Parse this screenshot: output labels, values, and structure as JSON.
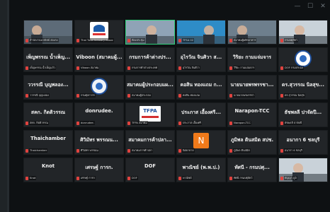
{
  "window": {
    "controls": [
      "—",
      "☐",
      "✕"
    ]
  },
  "colors": {
    "muted_mic": "#e0433f",
    "active_speaker": "#2fd07a",
    "avatar_n": "#f07a1a"
  },
  "tiles": [
    {
      "name": "",
      "label": "สำนักงานพาณิชย์ ฮ่องกง",
      "kind": "video"
    },
    {
      "name": "",
      "label": "Thai Tuna Industry Assoc",
      "kind": "logo"
    },
    {
      "name": "",
      "label": "ห้องประชุม",
      "kind": "video-room",
      "active": true
    },
    {
      "name": "",
      "label": "TFSA 02",
      "kind": "video"
    },
    {
      "name": "",
      "label": "สมาคมผู้ผลิตอาหาร",
      "kind": "video"
    },
    {
      "name": "",
      "label": "กรมปศุสัตว์",
      "kind": "video"
    },
    {
      "name": "เพ็ญพรรณ น้ำเพ็ญ...",
      "label": "เพ็ญพรรณ น้ำเพ็ญแก้ว",
      "kind": "name"
    },
    {
      "name": "Viboon (สมาคมผู้...",
      "label": "Viboon สมาคม",
      "kind": "name"
    },
    {
      "name": "กรมการค้าต่างปร...",
      "label": "กรมการค้าต่างประเทศ",
      "kind": "name"
    },
    {
      "name": "อุไรวัณ จินศิวา ส...",
      "label": "อุไรวัณ จินศิวา",
      "kind": "name"
    },
    {
      "name": "วิริยะ กามแจ่มจาร",
      "label": "วิริยะ กามแจ่มจาร",
      "kind": "name"
    },
    {
      "name": "",
      "label": "DOF กรมประมง",
      "kind": "logo-seal"
    },
    {
      "name": "ววรรณี บุญพลอง...",
      "label": "ววรรณี บุญพลอง",
      "kind": "name"
    },
    {
      "name": "",
      "label": "กรมศุลกากร",
      "kind": "logo-seal-blue"
    },
    {
      "name": "สมาคมผู้ประกอบแผ...",
      "label": "สมาคมผู้ประกอบ",
      "kind": "name"
    },
    {
      "name": "คอสิน ทองแถม ก...",
      "label": "คอสิน ทองแถม",
      "kind": "name"
    },
    {
      "name": "นายนายพรพรรชา...",
      "label": "นายนายพรพรรชา",
      "kind": "name"
    },
    {
      "name": "ดร.สุวรรณ นิลสุข...",
      "label": "ดร.สุวรรณ นิลสุข",
      "kind": "name"
    },
    {
      "name": "สคก. กิตติวรรณ",
      "label": "สคก. กิตติวรรณ",
      "kind": "name"
    },
    {
      "name": "donrudee.",
      "label": "donrudee.",
      "kind": "name"
    },
    {
      "name": "",
      "label": "TFPA สมาคม",
      "kind": "logo-tfpa"
    },
    {
      "name": "ประภาส เอื้องศรี...",
      "label": "ประภาส เอื้องศรี",
      "kind": "name"
    },
    {
      "name": "Narapon-TCC",
      "label": "Narapon-TCC",
      "kind": "name"
    },
    {
      "name": "ธัชพลลี ปาจัดปี...",
      "label": "ธัชพลลี ปาจัดปี",
      "kind": "name"
    },
    {
      "name": "Thaichamber",
      "label": "Thaichamber",
      "kind": "name"
    },
    {
      "name": "ศิวิมัทร พรรณน...",
      "label": "ศิวิมัทร พรรณน",
      "kind": "name"
    },
    {
      "name": "สมาคมการค้าปลา...",
      "label": "สมาคมการค้าปลา",
      "kind": "name"
    },
    {
      "name": "",
      "label": "นิตยายาย",
      "kind": "avatar-n",
      "initial": "N"
    },
    {
      "name": "ภูมิพล ตินสมิต สปช.",
      "label": "ภูมิพล ตินสมิต",
      "kind": "name"
    },
    {
      "name": "อนากา 6 ชลบุรี",
      "label": "อนากา 6 ชลบุรี",
      "kind": "name"
    },
    {
      "name": "Knot",
      "label": "Knot",
      "kind": "name"
    },
    {
      "name": "เศรษฐ์ การก.",
      "label": "เศรษฐ์ การก",
      "kind": "name"
    },
    {
      "name": "DOF",
      "label": "DOF",
      "kind": "name"
    },
    {
      "name": "พาณิชย์ (พ.พ.ป.)",
      "label": "พาณิชย์",
      "kind": "name"
    },
    {
      "name": "ทัศนี - กรมปศุ...",
      "label": "ทัศนี กรมปศุสัตว์",
      "kind": "name"
    },
    {
      "name": "",
      "label": "ธัญญา ภูมิ",
      "kind": "video-person"
    }
  ]
}
